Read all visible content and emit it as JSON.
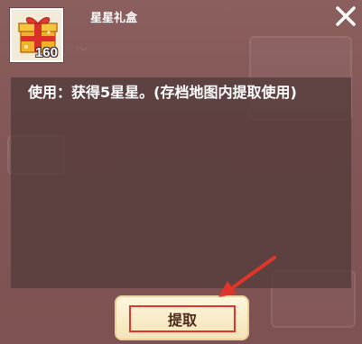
{
  "item": {
    "name": "星星礼盒",
    "count": "160",
    "description": "使用：获得5星星。(存档地图内提取使用)"
  },
  "actions": {
    "extract_label": "提取"
  },
  "icons": {
    "item": "gift-box-icon",
    "close": "close-icon",
    "pointer": "red-arrow-icon"
  },
  "colors": {
    "overlay": "#8a5b5b",
    "panel": "#553c3c",
    "button_fill": "#fff6dc",
    "highlight": "#e0352b"
  }
}
